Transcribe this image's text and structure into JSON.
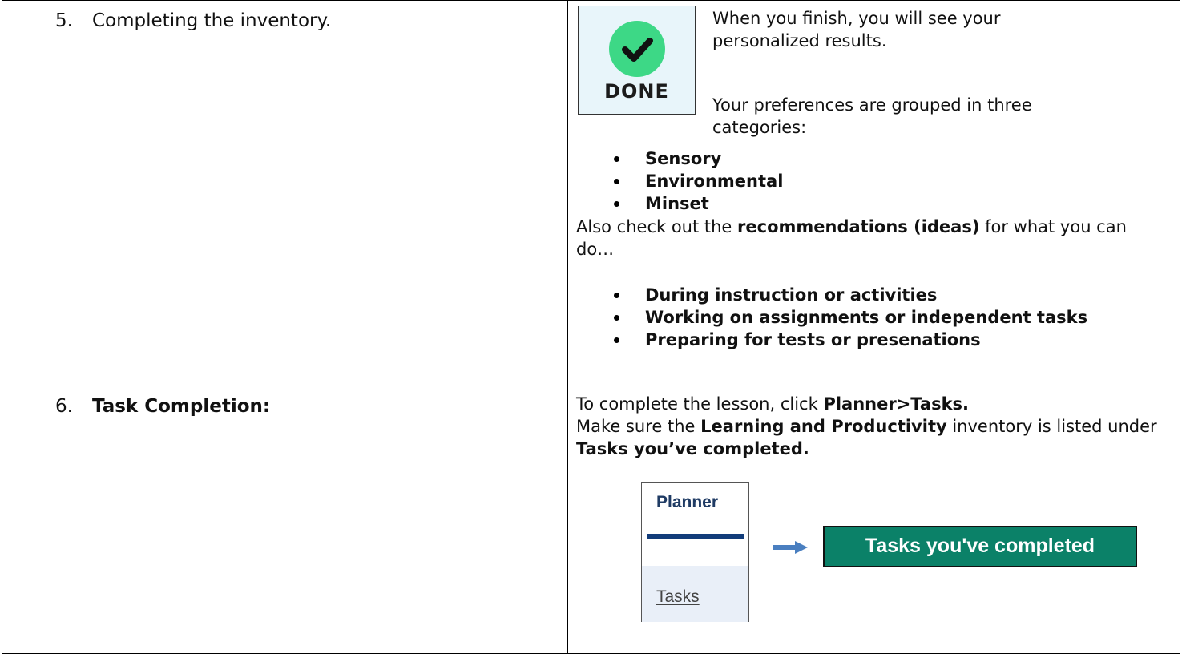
{
  "step5": {
    "number": "5.",
    "title": "Completing the inventory.",
    "done_badge_label": "DONE",
    "finish_text": "When you finish, you will see your personalized results.",
    "groups_text": "Your preferences are grouped in three categories:",
    "categories": [
      "Sensory",
      "Environmental",
      "Minset"
    ],
    "recommend_prefix": "Also check out the ",
    "recommend_bold": "recommendations (ideas)",
    "recommend_suffix": " for what you can do…",
    "recommendations": [
      "During instruction or activities",
      "Working on assignments or independent tasks",
      "Preparing for tests or presenations"
    ]
  },
  "step6": {
    "number": "6.",
    "title": "Task Completion:",
    "line1_prefix": "To complete the lesson, click ",
    "line1_bold": "Planner>Tasks.",
    "line2_prefix": "Make sure the ",
    "line2_bold": "Learning and Productivity",
    "line2_mid": " inventory is listed under ",
    "line2_bold2": "Tasks you’ve completed.",
    "planner_label": "Planner",
    "planner_tasks_label": "Tasks",
    "tasks_completed_button": "Tasks you've completed"
  },
  "colors": {
    "done_green": "#3dd886",
    "badge_bg": "#e8f5fa",
    "planner_navy": "#123c7a",
    "button_green": "#0b8168",
    "arrow_blue": "#4a7fc0"
  }
}
